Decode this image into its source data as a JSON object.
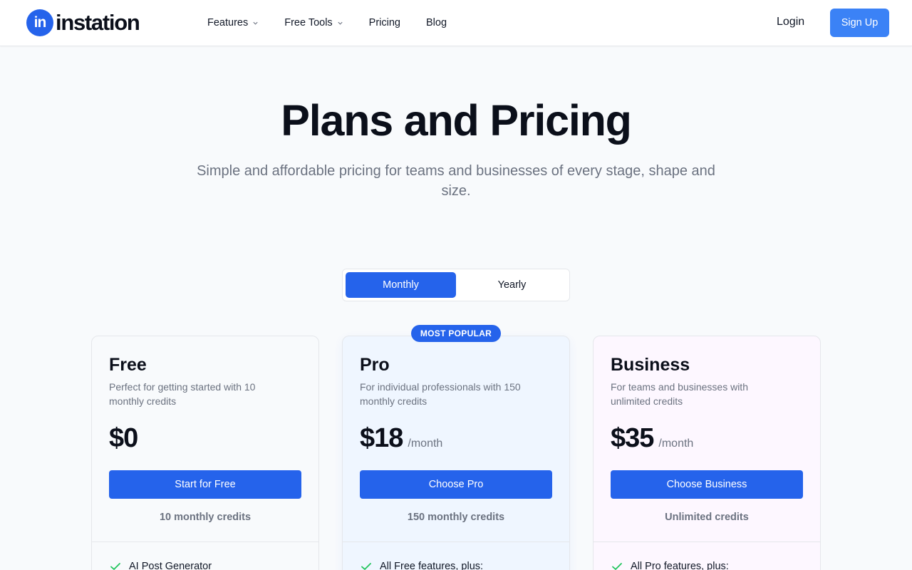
{
  "header": {
    "logo_mark": "in",
    "logo_word": "instation",
    "nav": [
      {
        "label": "Features",
        "has_dropdown": true
      },
      {
        "label": "Free Tools",
        "has_dropdown": true
      },
      {
        "label": "Pricing",
        "has_dropdown": false
      },
      {
        "label": "Blog",
        "has_dropdown": false
      }
    ],
    "login_label": "Login",
    "signup_label": "Sign Up"
  },
  "hero": {
    "title": "Plans and Pricing",
    "subtitle": "Simple and affordable pricing for teams and businesses of every stage, shape and size."
  },
  "billing_toggle": {
    "monthly_label": "Monthly",
    "yearly_label": "Yearly",
    "selected": "Monthly"
  },
  "badge": "MOST POPULAR",
  "plans": [
    {
      "name": "Free",
      "description": "Perfect for getting started with 10 monthly credits",
      "price": "$0",
      "period": "",
      "cta": "Start for Free",
      "credits": "10 monthly credits",
      "first_feature": "AI Post Generator"
    },
    {
      "name": "Pro",
      "description": "For individual professionals with 150 monthly credits",
      "price": "$18",
      "period": "/month",
      "cta": "Choose Pro",
      "credits": "150 monthly credits",
      "first_feature": "All Free features, plus:"
    },
    {
      "name": "Business",
      "description": "For teams and businesses with unlimited credits",
      "price": "$35",
      "period": "/month",
      "cta": "Choose Business",
      "credits": "Unlimited credits",
      "first_feature": "All Pro features, plus:"
    }
  ],
  "colors": {
    "primary": "#2563eb",
    "signup": "#3b82f6",
    "check": "#22c55e"
  }
}
